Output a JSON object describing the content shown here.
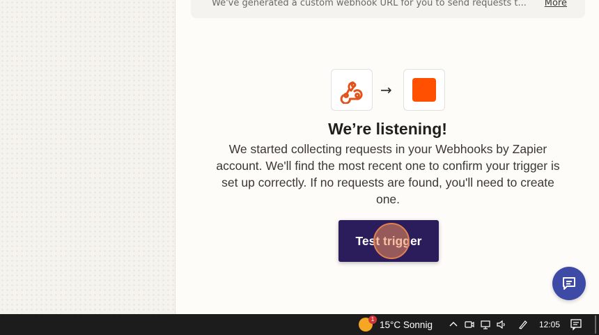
{
  "banner": {
    "text": "We've generated a custom webhook URL for you to send requests t...",
    "more_label": "More"
  },
  "steps": {
    "from_icon": "webhook-icon",
    "to_icon": "zapier-square-icon",
    "arrow": "→"
  },
  "listening": {
    "title": "We’re listening!",
    "description": "We started collecting requests in your Webhooks by Zapier account. We'll find the most recent one to confirm your trigger is set up correctly. If no requests are found, you'll need to create one."
  },
  "test_button": {
    "label": "Test trigger"
  },
  "chat": {
    "icon": "chat-icon"
  },
  "taskbar": {
    "weather": {
      "badge": "1",
      "text": "15°C  Sonnig"
    },
    "clock": "12:05"
  },
  "colors": {
    "brand_orange": "#ff4f00",
    "button_purple": "#2b1d5c",
    "chat_blue": "#3d4aa6"
  }
}
